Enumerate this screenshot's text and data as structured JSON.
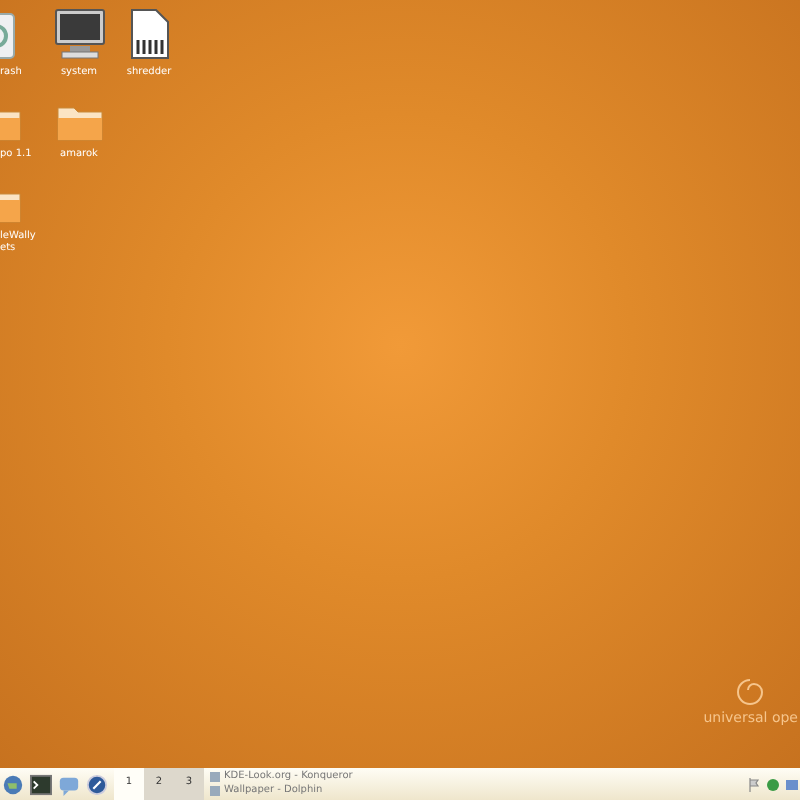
{
  "desktop_icons": [
    {
      "kind": "trash",
      "label": "rash"
    },
    {
      "kind": "monitor",
      "label": "system"
    },
    {
      "kind": "file",
      "label": "shredder"
    },
    {
      "kind": "folder",
      "label": "po 1.1"
    },
    {
      "kind": "folder",
      "label": "amarok"
    },
    {
      "kind": "empty"
    },
    {
      "kind": "folder",
      "label": "leWally\nets"
    }
  ],
  "watermark_text": "universal ope",
  "taskbar": {
    "desktops": [
      {
        "label": "1",
        "selected": true
      },
      {
        "label": "2",
        "selected": false
      },
      {
        "label": "3",
        "selected": false
      }
    ],
    "windows": [
      {
        "title": "KDE-Look.org - Konqueror"
      },
      {
        "title": "Wallpaper - Dolphin"
      }
    ]
  }
}
